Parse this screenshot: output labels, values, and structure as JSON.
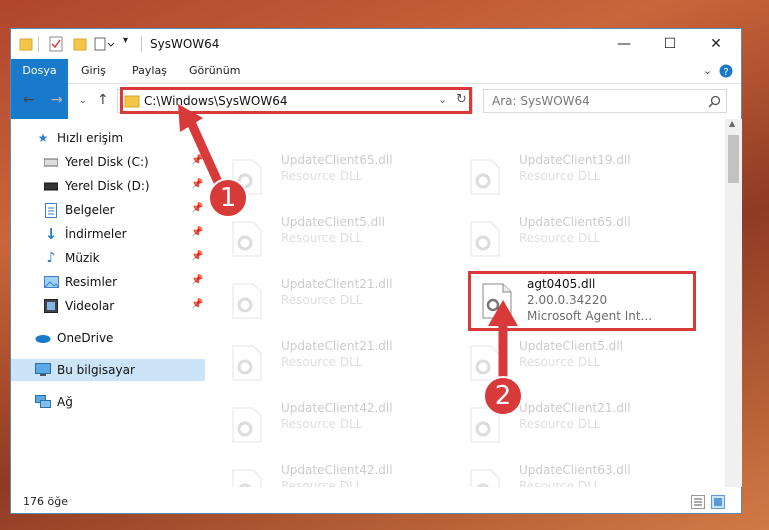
{
  "window": {
    "title": "SysWOW64"
  },
  "ribbon": {
    "tabs": [
      "Dosya",
      "Giriş",
      "Paylaş",
      "Görünüm"
    ]
  },
  "address": {
    "path": "C:\\Windows\\SysWOW64"
  },
  "search": {
    "placeholder": "Ara: SysWOW64"
  },
  "nav": {
    "items": [
      {
        "label": "Hızlı erişim",
        "icon": "star-icon"
      },
      {
        "label": "Yerel Disk (C:)",
        "icon": "drive-icon",
        "pinned": true
      },
      {
        "label": "Yerel Disk (D:)",
        "icon": "drive-icon",
        "pinned": true
      },
      {
        "label": "Belgeler",
        "icon": "document-icon",
        "pinned": true
      },
      {
        "label": "İndirmeler",
        "icon": "download-icon",
        "pinned": true
      },
      {
        "label": "Müzik",
        "icon": "music-icon",
        "pinned": true
      },
      {
        "label": "Resimler",
        "icon": "pictures-icon",
        "pinned": true
      },
      {
        "label": "Videolar",
        "icon": "videos-icon",
        "pinned": true
      },
      {
        "label": "OneDrive",
        "icon": "cloud-icon"
      },
      {
        "label": "Bu bilgisayar",
        "icon": "computer-icon",
        "selected": true
      },
      {
        "label": "Ağ",
        "icon": "network-icon"
      }
    ]
  },
  "files": {
    "left": [
      {
        "name": "UpdateClient65.dll",
        "type": "Resource DLL"
      },
      {
        "name": "UpdateClient5.dll",
        "type": "Resource DLL"
      },
      {
        "name": "UpdateClient21.dll",
        "type": "Resource DLL"
      },
      {
        "name": "UpdateClient21.dll",
        "type": "Resource DLL"
      },
      {
        "name": "UpdateClient42.dll",
        "type": "Resource DLL"
      },
      {
        "name": "UpdateClient42.dll",
        "type": "Resource DLL"
      }
    ],
    "right": [
      {
        "name": "UpdateClient19.dll",
        "type": "Resource DLL"
      },
      {
        "name": "UpdateClient65.dll",
        "type": "Resource DLL"
      },
      {
        "name": "agt0405.dll",
        "version": "2.00.0.34220",
        "desc": "Microsoft Agent Int...",
        "highlighted": true
      },
      {
        "name": "UpdateClient5.dll",
        "type": "Resource DLL"
      },
      {
        "name": "UpdateClient21.dll",
        "type": "Resource DLL"
      },
      {
        "name": "UpdateClient63.dll",
        "type": "Resource DLL"
      }
    ]
  },
  "status": {
    "item_count": "176 öğe"
  },
  "annotations": {
    "step1": "1",
    "step2": "2",
    "color": "#d83a3a"
  }
}
